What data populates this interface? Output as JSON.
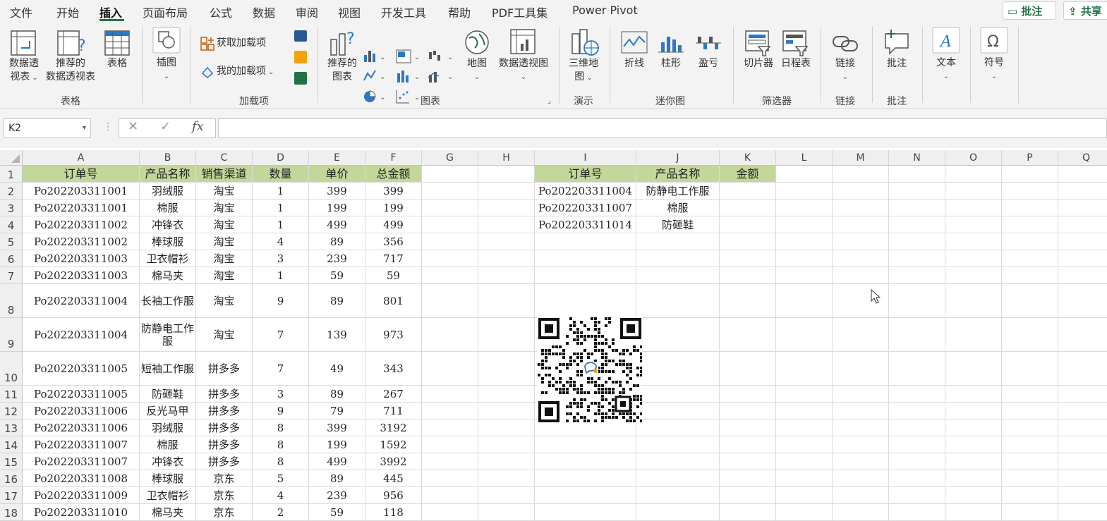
{
  "menu": {
    "tabs": [
      "文件",
      "开始",
      "插入",
      "页面布局",
      "公式",
      "数据",
      "审阅",
      "视图",
      "开发工具",
      "帮助",
      "PDF工具集",
      "Power Pivot"
    ],
    "active": "插入",
    "comments_button": "批注",
    "share_button": "共享"
  },
  "ribbon": {
    "pivot_table": [
      "数据透",
      "视表"
    ],
    "recommended_pivot": [
      "推荐的",
      "数据透视表"
    ],
    "table": "表格",
    "group_tables": "表格",
    "illustrations": "插图",
    "get_addins": "获取加载项",
    "my_addins": "我的加载项",
    "group_addins": "加载项",
    "recommended_charts": [
      "推荐的",
      "图表"
    ],
    "maps": "地图",
    "pivot_chart": "数据透视图",
    "group_charts": "图表",
    "map3d": [
      "三维地",
      "图"
    ],
    "group_tours": "演示",
    "spark_line": "折线",
    "spark_column": "柱形",
    "spark_winloss": "盈亏",
    "group_sparklines": "迷你图",
    "slicer": "切片器",
    "timeline": "日程表",
    "group_filters": "筛选器",
    "link": "链接",
    "group_links": "链接",
    "comment": "批注",
    "group_comments": "批注",
    "text": "文本",
    "symbols": "符号"
  },
  "formula_bar": {
    "name_box": "K2",
    "cancel_glyph": "✕",
    "enter_glyph": "✓",
    "fx": "fx",
    "formula": ""
  },
  "sheet": {
    "columns": [
      "A",
      "B",
      "C",
      "D",
      "E",
      "F",
      "G",
      "H",
      "I",
      "J",
      "K",
      "L",
      "M",
      "N",
      "O",
      "P",
      "Q"
    ],
    "rows": [
      {
        "n": "1",
        "c": [
          "订单号",
          "产品名称",
          "销售渠道",
          "数量",
          "单价",
          "总金额"
        ],
        "r": [
          "订单号",
          "产品名称",
          "金额"
        ]
      },
      {
        "n": "2",
        "c": [
          "Po202203311001",
          "羽绒服",
          "淘宝",
          "1",
          "399",
          "399"
        ],
        "r": [
          "Po202203311004",
          "防静电工作服",
          ""
        ]
      },
      {
        "n": "3",
        "c": [
          "Po202203311001",
          "棉服",
          "淘宝",
          "1",
          "199",
          "199"
        ],
        "r": [
          "Po202203311007",
          "棉服",
          ""
        ]
      },
      {
        "n": "4",
        "c": [
          "Po202203311002",
          "冲锋衣",
          "淘宝",
          "1",
          "499",
          "499"
        ],
        "r": [
          "Po202203311014",
          "防砸鞋",
          ""
        ]
      },
      {
        "n": "5",
        "c": [
          "Po202203311002",
          "棒球服",
          "淘宝",
          "4",
          "89",
          "356"
        ]
      },
      {
        "n": "6",
        "c": [
          "Po202203311003",
          "卫衣帽衫",
          "淘宝",
          "3",
          "239",
          "717"
        ]
      },
      {
        "n": "7",
        "c": [
          "Po202203311003",
          "棉马夹",
          "淘宝",
          "1",
          "59",
          "59"
        ]
      },
      {
        "n": "8",
        "c": [
          "Po202203311004",
          "长袖工作服",
          "淘宝",
          "9",
          "89",
          "801"
        ]
      },
      {
        "n": "9",
        "c": [
          "Po202203311004",
          "防静电工作服",
          "淘宝",
          "7",
          "139",
          "973"
        ]
      },
      {
        "n": "10",
        "c": [
          "Po202203311005",
          "短袖工作服",
          "拼多多",
          "7",
          "49",
          "343"
        ]
      },
      {
        "n": "11",
        "c": [
          "Po202203311005",
          "防砸鞋",
          "拼多多",
          "3",
          "89",
          "267"
        ]
      },
      {
        "n": "12",
        "c": [
          "Po202203311006",
          "反光马甲",
          "拼多多",
          "9",
          "79",
          "711"
        ]
      },
      {
        "n": "13",
        "c": [
          "Po202203311006",
          "羽绒服",
          "拼多多",
          "8",
          "399",
          "3192"
        ]
      },
      {
        "n": "14",
        "c": [
          "Po202203311007",
          "棉服",
          "拼多多",
          "8",
          "199",
          "1592"
        ]
      },
      {
        "n": "15",
        "c": [
          "Po202203311007",
          "冲锋衣",
          "拼多多",
          "8",
          "499",
          "3992"
        ]
      },
      {
        "n": "16",
        "c": [
          "Po202203311008",
          "棒球服",
          "京东",
          "5",
          "89",
          "445"
        ]
      },
      {
        "n": "17",
        "c": [
          "Po202203311009",
          "卫衣帽衫",
          "京东",
          "4",
          "239",
          "956"
        ]
      },
      {
        "n": "18",
        "c": [
          "Po202203311010",
          "棉马夹",
          "京东",
          "2",
          "59",
          "118"
        ]
      }
    ]
  },
  "colors": {
    "accent": "#217346",
    "header_fill": "#c4d79b"
  }
}
